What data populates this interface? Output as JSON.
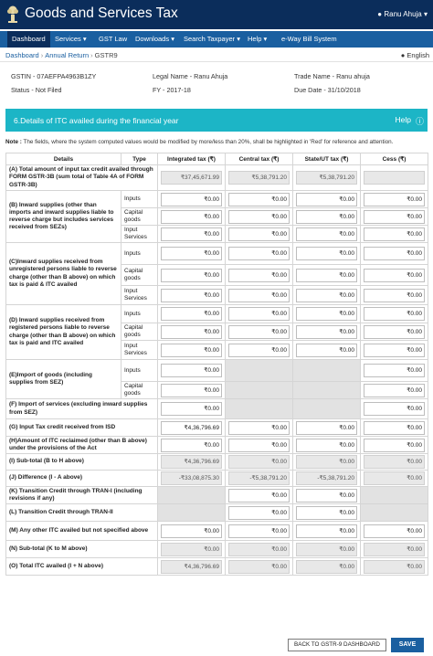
{
  "header": {
    "title": "Goods and Services Tax",
    "user_name": "Ranu Ahuja"
  },
  "nav": {
    "items": [
      {
        "label": "Dashboard",
        "active": true,
        "has_dropdown": false
      },
      {
        "label": "Services",
        "active": false,
        "has_dropdown": true
      },
      {
        "label": "GST Law",
        "active": false,
        "has_dropdown": false
      },
      {
        "label": "Downloads",
        "active": false,
        "has_dropdown": true
      },
      {
        "label": "Search Taxpayer",
        "active": false,
        "has_dropdown": true
      },
      {
        "label": "Help",
        "active": false,
        "has_dropdown": true
      },
      {
        "label": "e-Way Bill System",
        "active": false,
        "has_dropdown": false
      }
    ]
  },
  "breadcrumb": {
    "items": [
      "Dashboard",
      "Annual Return",
      "GSTR9"
    ],
    "separator": "›"
  },
  "language": "English",
  "taxpayer": {
    "gstin": "GSTIN - 07AEFPA4963B1ZY",
    "status": "Status - Not Filed",
    "legal_name": "Legal Name - Ranu Ahuja",
    "fy": "FY - 2017-18",
    "trade_name": "Trade Name - Ranu ahuja",
    "due_date": "Due Date - 31/10/2018"
  },
  "section": {
    "title": "6.Details of ITC availed during the financial year",
    "help_label": "Help"
  },
  "note": {
    "label": "Note :",
    "text": "The fields, where the system computed values would be modified by more/less than 20%, shall be highlighted in 'Red' for reference and attention."
  },
  "table": {
    "columns": [
      "Details",
      "Type",
      "Integrated tax (₹)",
      "Central tax (₹)",
      "State/UT tax (₹)",
      "Cess (₹)"
    ],
    "rows": [
      {
        "label": "(A) Total amount of input tax credit availed through FORM GSTR-3B (sum total of Table 4A of FORM GSTR-3B)",
        "type": "",
        "values": [
          "₹37,45,671.99",
          "₹5,38,791.20",
          "₹5,38,791.20",
          ""
        ],
        "disabled": [
          "ro",
          "ro",
          "ro",
          "ro"
        ]
      },
      {
        "label": "(B) Inward supplies (other than imports and inward supplies liable to reverse charge but includes services received from SEZs)",
        "type": "Inputs",
        "values": [
          "₹0.00",
          "₹0.00",
          "₹0.00",
          "₹0.00"
        ],
        "disabled": [
          "",
          "",
          "",
          ""
        ]
      },
      {
        "label": "",
        "type": "Capital goods",
        "values": [
          "₹0.00",
          "₹0.00",
          "₹0.00",
          "₹0.00"
        ],
        "disabled": [
          "",
          "",
          "",
          ""
        ]
      },
      {
        "label": "",
        "type": "Input Services",
        "values": [
          "₹0.00",
          "₹0.00",
          "₹0.00",
          "₹0.00"
        ],
        "disabled": [
          "",
          "",
          "",
          ""
        ]
      },
      {
        "label": "(C)Inward supplies received from unregistered persons liable to reverse charge (other than B above) on which tax is paid & ITC availed",
        "type": "Inputs",
        "values": [
          "₹0.00",
          "₹0.00",
          "₹0.00",
          "₹0.00"
        ],
        "disabled": [
          "",
          "",
          "",
          ""
        ]
      },
      {
        "label": "",
        "type": "Capital goods",
        "values": [
          "₹0.00",
          "₹0.00",
          "₹0.00",
          "₹0.00"
        ],
        "disabled": [
          "",
          "",
          "",
          ""
        ]
      },
      {
        "label": "",
        "type": "Input Services",
        "values": [
          "₹0.00",
          "₹0.00",
          "₹0.00",
          "₹0.00"
        ],
        "disabled": [
          "",
          "",
          "",
          ""
        ]
      },
      {
        "label": "(D) Inward supplies received from registered persons liable to reverse charge (other than B above) on which tax is paid and ITC availed",
        "type": "Inputs",
        "values": [
          "₹0.00",
          "₹0.00",
          "₹0.00",
          "₹0.00"
        ],
        "disabled": [
          "",
          "",
          "",
          ""
        ]
      },
      {
        "label": "",
        "type": "Capital goods",
        "values": [
          "₹0.00",
          "₹0.00",
          "₹0.00",
          "₹0.00"
        ],
        "disabled": [
          "",
          "",
          "",
          ""
        ]
      },
      {
        "label": "",
        "type": "Input Services",
        "values": [
          "₹0.00",
          "₹0.00",
          "₹0.00",
          "₹0.00"
        ],
        "disabled": [
          "",
          "",
          "",
          ""
        ]
      },
      {
        "label": "(E)Import of goods (including supplies from SEZ)",
        "type": "Inputs",
        "values": [
          "₹0.00",
          null,
          null,
          "₹0.00"
        ],
        "disabled": [
          "",
          "",
          "",
          ""
        ]
      },
      {
        "label": "",
        "type": "Capital goods",
        "values": [
          "₹0.00",
          null,
          null,
          "₹0.00"
        ],
        "disabled": [
          "",
          "",
          "",
          ""
        ]
      },
      {
        "label": "(F) Import of services (excluding inward supplies from SEZ)",
        "type": "",
        "values": [
          "₹0.00",
          null,
          null,
          "₹0.00"
        ],
        "disabled": [
          "",
          "",
          "",
          ""
        ]
      },
      {
        "label": "(G) Input Tax credit received from ISD",
        "type": "",
        "values": [
          "₹4,36,796.69",
          "₹0.00",
          "₹0.00",
          "₹0.00"
        ],
        "disabled": [
          "",
          "",
          "",
          ""
        ]
      },
      {
        "label": "(H)Amount of ITC reclaimed (other than B above) under the provisions of the Act",
        "type": "",
        "values": [
          "₹0.00",
          "₹0.00",
          "₹0.00",
          "₹0.00"
        ],
        "disabled": [
          "",
          "",
          "",
          ""
        ]
      },
      {
        "label": "(I) Sub-total (B to H above)",
        "type": "",
        "values": [
          "₹4,36,796.69",
          "₹0.00",
          "₹0.00",
          "₹0.00"
        ],
        "disabled": [
          "ro",
          "ro",
          "ro",
          "ro"
        ]
      },
      {
        "label": "(J) Difference (I - A above)",
        "type": "",
        "values": [
          "-₹33,08,875.30",
          "-₹5,38,791.20",
          "-₹5,38,791.20",
          "₹0.00"
        ],
        "disabled": [
          "ro",
          "ro",
          "ro",
          "ro"
        ]
      },
      {
        "label": "(K) Transition Credit through TRAN-I (including revisions if any)",
        "type": "",
        "values": [
          null,
          "₹0.00",
          "₹0.00",
          null
        ],
        "disabled": [
          "",
          "",
          "",
          ""
        ]
      },
      {
        "label": "(L) Transition Credit through TRAN-II",
        "type": "",
        "values": [
          null,
          "₹0.00",
          "₹0.00",
          null
        ],
        "disabled": [
          "",
          "",
          "",
          ""
        ]
      },
      {
        "label": "(M) Any other ITC availed but not specified above",
        "type": "",
        "values": [
          "₹0.00",
          "₹0.00",
          "₹0.00",
          "₹0.00"
        ],
        "disabled": [
          "",
          "",
          "",
          ""
        ]
      },
      {
        "label": "(N) Sub-total (K to M above)",
        "type": "",
        "values": [
          "₹0.00",
          "₹0.00",
          "₹0.00",
          "₹0.00"
        ],
        "disabled": [
          "ro",
          "ro",
          "ro",
          "ro"
        ]
      },
      {
        "label": "(O) Total ITC availed (I + N above)",
        "type": "",
        "values": [
          "₹4,36,796.69",
          "₹0.00",
          "₹0.00",
          "₹0.00"
        ],
        "disabled": [
          "ro",
          "ro",
          "ro",
          "ro"
        ]
      }
    ]
  },
  "buttons": {
    "back": "BACK TO GSTR-9 DASHBOARD",
    "save": "SAVE"
  },
  "colors": {
    "header_bg": "#0b2d5b",
    "nav_bg": "#1a5fa0",
    "section_bg": "#1cb5c6",
    "disabled_cell": "#e2e2e2",
    "readonly_input": "#e8e8e8"
  }
}
